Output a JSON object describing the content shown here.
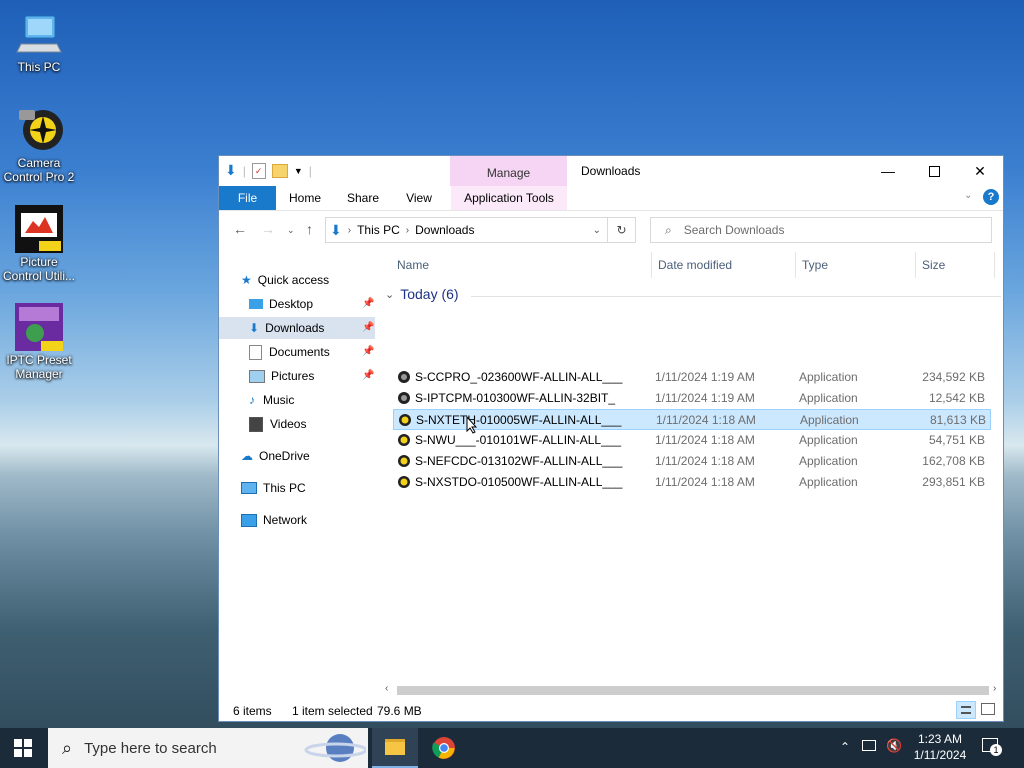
{
  "desktop": {
    "icons": [
      {
        "label": "This PC"
      },
      {
        "label": "Camera Control Pro 2"
      },
      {
        "label": "Picture Control Utili..."
      },
      {
        "label": "IPTC Preset Manager"
      }
    ]
  },
  "window": {
    "title": "Downloads",
    "context_tab": "Manage",
    "ribbon_tabs": [
      "File",
      "Home",
      "Share",
      "View",
      "Application Tools"
    ],
    "address": {
      "root": "This PC",
      "current": "Downloads"
    },
    "search_placeholder": "Search Downloads",
    "nav": {
      "quick_access": "Quick access",
      "items": [
        "Desktop",
        "Downloads",
        "Documents",
        "Pictures",
        "Music",
        "Videos"
      ],
      "onedrive": "OneDrive",
      "this_pc": "This PC",
      "network": "Network"
    },
    "columns": {
      "name": "Name",
      "date": "Date modified",
      "type": "Type",
      "size": "Size"
    },
    "group_label": "Today (6)",
    "files": [
      {
        "name": "S-CCPRO_-023600WF-ALLIN-ALL___",
        "date": "1/11/2024 1:19 AM",
        "type": "Application",
        "size": "234,592 KB"
      },
      {
        "name": "S-IPTCPM-010300WF-ALLIN-32BIT_",
        "date": "1/11/2024 1:19 AM",
        "type": "Application",
        "size": "12,542 KB"
      },
      {
        "name": "S-NXTETH-010005WF-ALLIN-ALL___",
        "date": "1/11/2024 1:18 AM",
        "type": "Application",
        "size": "81,613 KB"
      },
      {
        "name": "S-NWU___-010101WF-ALLIN-ALL___",
        "date": "1/11/2024 1:18 AM",
        "type": "Application",
        "size": "54,751 KB"
      },
      {
        "name": "S-NEFCDC-013102WF-ALLIN-ALL___",
        "date": "1/11/2024 1:18 AM",
        "type": "Application",
        "size": "162,708 KB"
      },
      {
        "name": "S-NXSTDO-010500WF-ALLIN-ALL___",
        "date": "1/11/2024 1:18 AM",
        "type": "Application",
        "size": "293,851 KB"
      }
    ],
    "status": {
      "items": "6 items",
      "selected": "1 item selected",
      "selected_size": "79.6 MB"
    }
  },
  "taskbar": {
    "search_placeholder": "Type here to search",
    "time": "1:23 AM",
    "date": "1/11/2024",
    "notification_count": "1"
  },
  "colors": {
    "accent": "#1979ca",
    "selection": "#cce8ff",
    "context_tab": "#f5d5f3"
  }
}
